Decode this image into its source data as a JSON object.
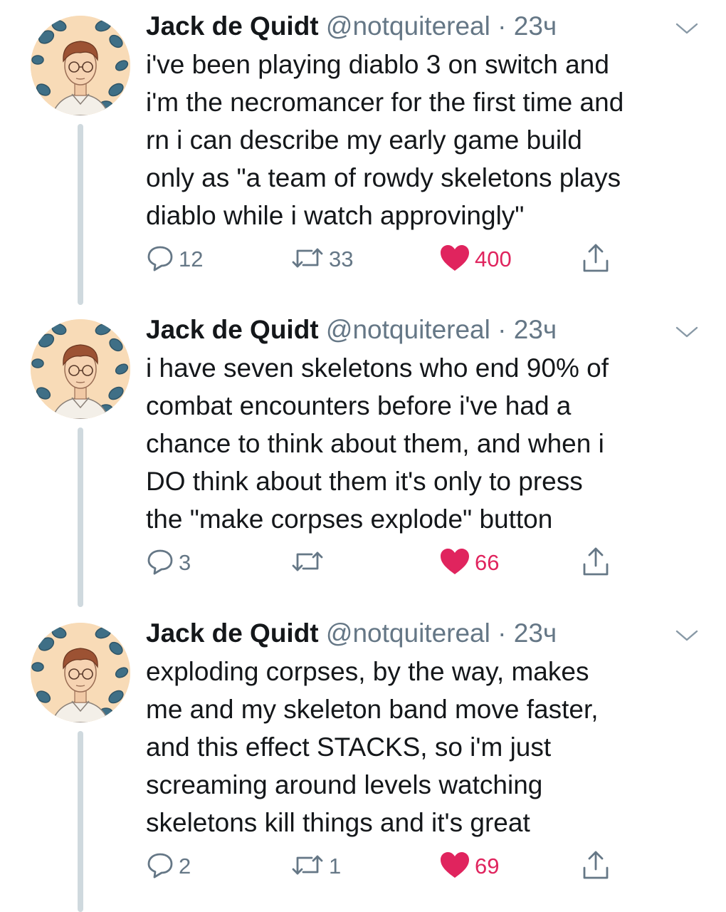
{
  "icons": {
    "reply": "reply-icon",
    "retweet": "retweet-icon",
    "like": "heart-icon",
    "share": "share-icon",
    "menu": "chevron-down-icon"
  },
  "colors": {
    "name": "#14171a",
    "secondary": "#657786",
    "like": "#e0245e",
    "thread_line": "#cfd9de"
  },
  "tweets": [
    {
      "author": "Jack de Quidt",
      "handle": "@notquitereal",
      "separator": "·",
      "time": "23ч",
      "text": "i've been playing diablo 3 on switch and\ni'm the necromancer for the first time and\nrn i can describe my early game build\nonly as \"a team of rowdy skeletons plays\ndiablo while i watch approvingly\"",
      "replies": "12",
      "retweets": "33",
      "likes": "400"
    },
    {
      "author": "Jack de Quidt",
      "handle": "@notquitereal",
      "separator": "·",
      "time": "23ч",
      "text": "i have seven skeletons who end 90% of\ncombat encounters before i've had a\nchance to think about them, and when i\nDO think about them it's only to press\nthe \"make corpses explode\" button",
      "replies": "3",
      "retweets": "",
      "likes": "66"
    },
    {
      "author": "Jack de Quidt",
      "handle": "@notquitereal",
      "separator": "·",
      "time": "23ч",
      "text": "exploding corpses, by the way, makes\nme and my skeleton band move faster,\nand this effect STACKS, so i'm just\nscreaming around levels watching\nskeletons kill things and it's great",
      "replies": "2",
      "retweets": "1",
      "likes": "69"
    }
  ]
}
